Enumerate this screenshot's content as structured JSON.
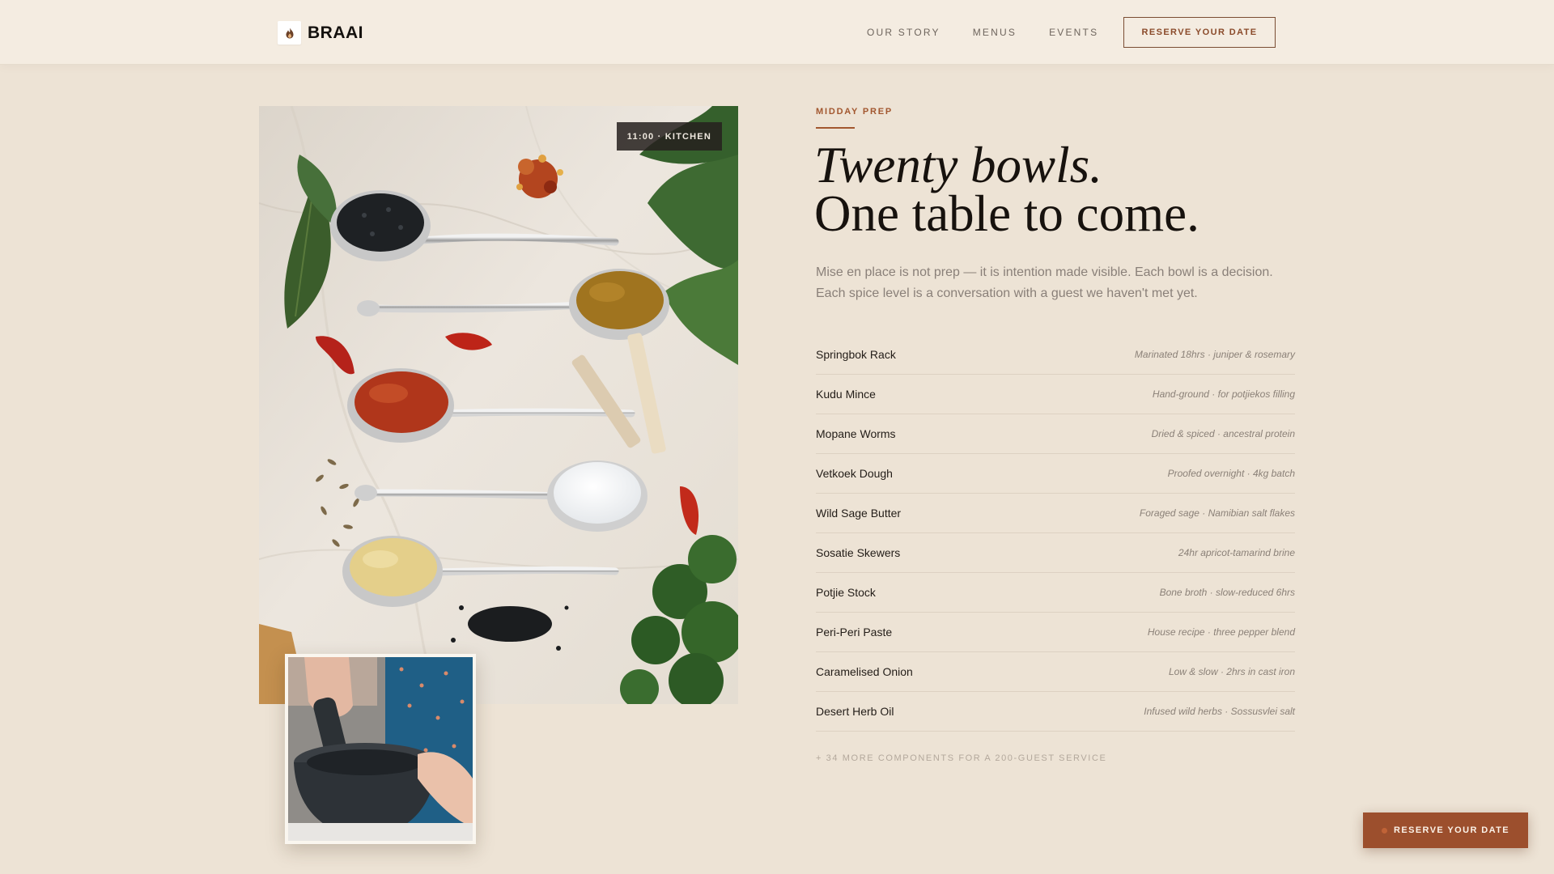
{
  "header": {
    "brand": "BRAAI",
    "brand_icon": "flame-icon",
    "nav": [
      "OUR STORY",
      "MENUS",
      "EVENTS"
    ],
    "cta_label": "RESERVE YOUR DATE"
  },
  "photo": {
    "badge": "11:00 · KITCHEN",
    "main_subject": "spices-on-spoons",
    "inset_subject": "mortar-and-pestle"
  },
  "section": {
    "eyebrow": "MIDDAY PREP",
    "headline_line1": "Twenty bowls.",
    "headline_line2": "One table to come.",
    "intro": "Mise en place is not prep — it is intention made visible. Each bowl is a decision. Each spice level is a conversation with a guest we haven't met yet."
  },
  "ingredients": [
    {
      "name": "Springbok Rack",
      "note": "Marinated 18hrs · juniper & rosemary"
    },
    {
      "name": "Kudu Mince",
      "note": "Hand-ground · for potjiekos filling"
    },
    {
      "name": "Mopane Worms",
      "note": "Dried & spiced · ancestral protein"
    },
    {
      "name": "Vetkoek Dough",
      "note": "Proofed overnight · 4kg batch"
    },
    {
      "name": "Wild Sage Butter",
      "note": "Foraged sage · Namibian salt flakes"
    },
    {
      "name": "Sosatie Skewers",
      "note": "24hr apricot-tamarind brine"
    },
    {
      "name": "Potjie Stock",
      "note": "Bone broth · slow-reduced 6hrs"
    },
    {
      "name": "Peri-Peri Paste",
      "note": "House recipe · three pepper blend"
    },
    {
      "name": "Caramelised Onion",
      "note": "Low & slow · 2hrs in cast iron"
    },
    {
      "name": "Desert Herb Oil",
      "note": "Infused wild herbs · Sossusvlei salt"
    }
  ],
  "more_note": "+ 34 MORE COMPONENTS FOR A 200-GUEST SERVICE",
  "floating_cta": {
    "label": "RESERVE YOUR DATE"
  },
  "colors": {
    "page_bg": "#ede3d5",
    "header_bg": "#f4ece1",
    "accent": "#a2572f",
    "cta_bg": "#9c4f2d",
    "text_dark": "#17120e",
    "text_muted": "#8a8079"
  }
}
